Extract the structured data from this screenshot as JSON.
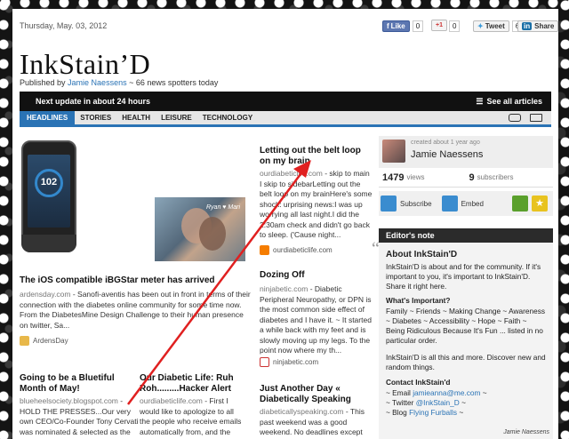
{
  "header": {
    "date": "Thursday, May. 03, 2012",
    "title": "InkStain’D",
    "published_prefix": "Published by ",
    "author": "Jamie Naessens",
    "published_suffix": " ~ 66 news spotters today"
  },
  "social": {
    "like": "Like",
    "like_count": "0",
    "plus": "+1",
    "plus_count": "0",
    "tweet": "Tweet",
    "tweet_count": "6",
    "linkedin": "in",
    "share": "Share"
  },
  "bar": {
    "update": "Next update in about 24 hours",
    "see_all": "See all articles"
  },
  "nav": {
    "tabs": [
      "HEADLINES",
      "STORIES",
      "HEALTH",
      "LEISURE",
      "TECHNOLOGY"
    ]
  },
  "articles": {
    "a1": {
      "title": "The iOS compatible iBGStar meter has arrived",
      "source": "ardensday.com",
      "body": " - Sanofi-aventis has been out in front in terms of their connection with the diabetes online community for some time now. From the DiabetesMine Design Challenge to their human presence on twitter, Sa...",
      "author": "ArdensDay"
    },
    "a2": {
      "title": "Letting out the belt loop on my brain",
      "source": "ourdiabeticlife.com",
      "body": " - skip to main I skip to sidebarLetting out the belt loop on my brainHere's some shock: urprising news:I was up worrying all last night.I did the 2:30am check and didn't go back to sleep.  ('Cause night...",
      "footer": "ourdiabeticlife.com"
    },
    "a3": {
      "title": "Dozing Off",
      "source": "ninjabetic.com",
      "body": " - Diabetic Peripheral Neuropathy, or DPN is the most common side effect of diabetes and I have it. ~ It started a while back with my feet and is slowly moving up my legs. To the point now where my th...",
      "footer": "ninjabetic.com"
    },
    "a4": {
      "title": "Going to be a Bluetiful Month of May!",
      "source": "blueheelsociety.blogspot.com",
      "body": " - HOLD THE PRESSES...Our very own CEO/Co-Founder Tony Cervati was nominated & selected as the winner of Nabl..."
    },
    "a5": {
      "title": "Our Diabetic Life: Ruh Roh.........Hacker Alert",
      "source": "ourdiabeticlife.com",
      "body": " - First I would like to apologize to all the people who receive emails automatically from, and the group of readers who subscribe to OUR DIABETIC..."
    },
    "a6": {
      "title": "Just Another Day « Diabetically Speaking",
      "source": "diabeticallyspeaking.com",
      "body": " - This past weekend was a good weekend. No deadlines except"
    },
    "image_caption": "Ryan ♥ Mari",
    "phone_value": "102"
  },
  "profile": {
    "created": "created about 1 year ago",
    "name": "Jamie Naessens",
    "views_count": "1479",
    "views_label": "views",
    "subs_count": "9",
    "subs_label": "subscribers",
    "subscribe": "Subscribe",
    "embed": "Embed"
  },
  "editor": {
    "header": "Editor's note",
    "title": "About InkStain'D",
    "p1": "InkStain'D is about and for the community. If it's important to you, it's important to InkStain'D. Share it right here.",
    "p2_title": "What's Important?",
    "p2": "Family ~ Friends ~ Making Change ~ Awareness ~ Diabetes ~ Accessibility ~ Hope ~ Faith ~ Being Ridiculous Because It's Fun ... listed in no particular order.",
    "p3": "InkStain'D is all this and more. Discover new and random things.",
    "contact_title": "Contact InkStain'd",
    "email_prefix": "~ Email ",
    "email": "jamieanna@me.com",
    "email_suffix": " ~",
    "twitter_prefix": "~ Twitter ",
    "twitter": "@InkStain_D",
    "twitter_suffix": " ~",
    "blog_prefix": "~ Blog ",
    "blog": "Flying Furballs",
    "blog_suffix": " ~",
    "credit": "Jamie Naessens"
  },
  "colors": {
    "accent": "#2a73b5",
    "annotation_arrow": "#e02020"
  }
}
